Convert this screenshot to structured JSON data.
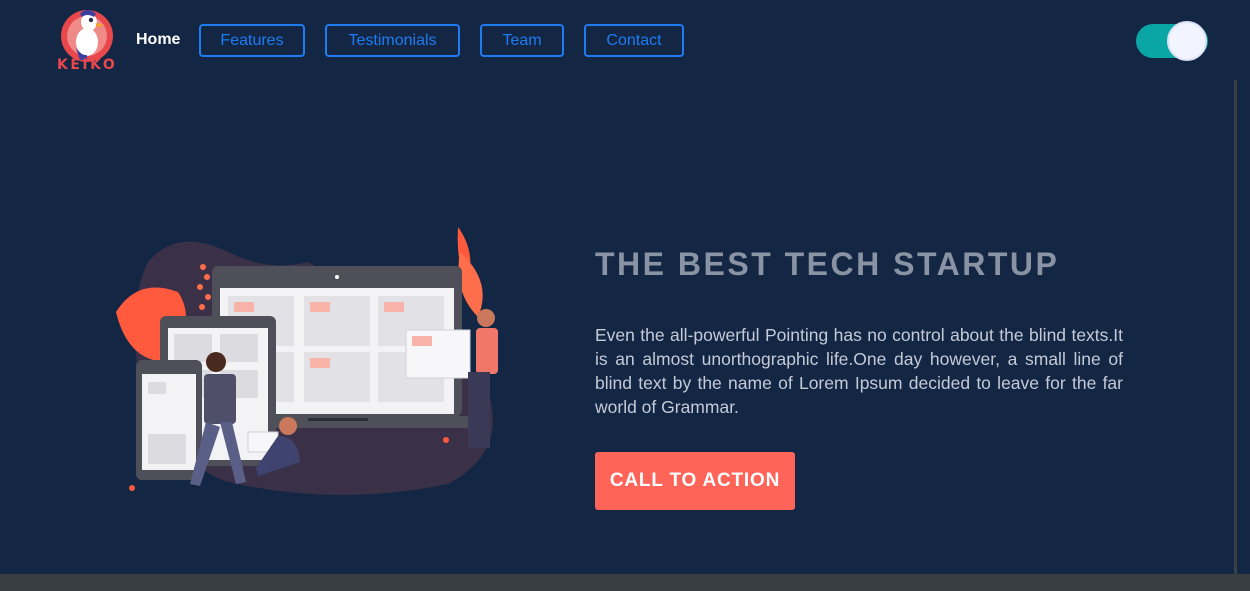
{
  "brand": {
    "name": "KEIKO"
  },
  "nav": {
    "home": "Home",
    "items": [
      "Features",
      "Testimonials",
      "Team",
      "Contact"
    ]
  },
  "theme_toggle": {
    "state": "on"
  },
  "hero": {
    "title": "THE BEST TECH STARTUP",
    "body": "Even the all-powerful Pointing has no control about the blind texts.It is an almost unorthographic life.One day however, a small line of blind text by the name of Lorem Ipsum decided to leave for the far world of Grammar.",
    "cta": "CALL TO ACTION"
  },
  "colors": {
    "background": "#132644",
    "nav_accent": "#1e7cf2",
    "toggle": "#0aa6a6",
    "cta": "#ff6459",
    "title": "#8993a3"
  }
}
